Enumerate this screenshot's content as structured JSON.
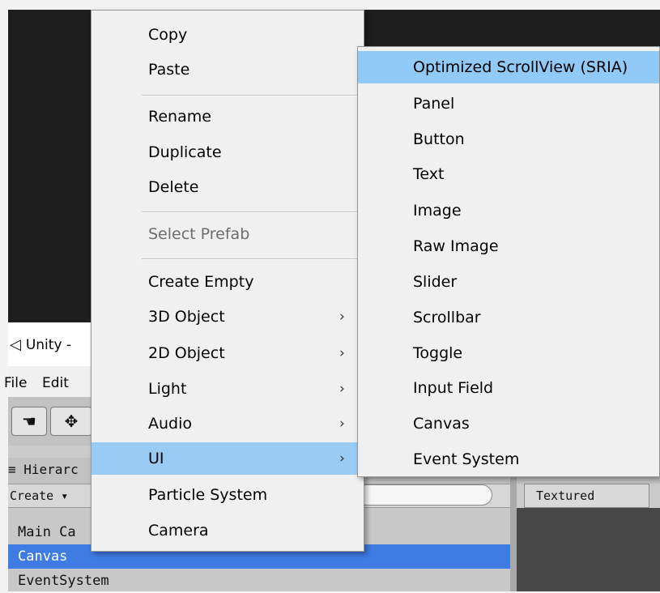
{
  "window": {
    "title": "Unity -",
    "logo_icon": "unity-logo-icon"
  },
  "menubar": {
    "items": [
      "File",
      "Edit"
    ]
  },
  "toolbar": {
    "hand_icon": "hand-tool-icon",
    "move_icon": "move-tool-icon"
  },
  "hierarchy": {
    "tab_label": "≡ Hierarc",
    "create_label": "Create ▾",
    "rows": [
      "Main Ca",
      "Canvas",
      "EventSystem"
    ],
    "selected_row": "Canvas"
  },
  "scene": {
    "textured_label": "Textured"
  },
  "context_menu": {
    "items": [
      {
        "label": "Copy"
      },
      {
        "label": "Paste"
      },
      {
        "label": "Rename"
      },
      {
        "label": "Duplicate"
      },
      {
        "label": "Delete"
      },
      {
        "label": "Select Prefab",
        "disabled": true
      },
      {
        "label": "Create Empty"
      },
      {
        "label": "3D Object",
        "submenu": true
      },
      {
        "label": "2D Object",
        "submenu": true
      },
      {
        "label": "Light",
        "submenu": true
      },
      {
        "label": "Audio",
        "submenu": true
      },
      {
        "label": "UI",
        "submenu": true,
        "highlighted": true
      },
      {
        "label": "Particle System"
      },
      {
        "label": "Camera"
      }
    ],
    "submenu_arrow": "›"
  },
  "ui_submenu": {
    "items": [
      {
        "label": "Optimized ScrollView (SRIA)",
        "highlighted": true
      },
      {
        "label": "Panel"
      },
      {
        "label": "Button"
      },
      {
        "label": "Text"
      },
      {
        "label": "Image"
      },
      {
        "label": "Raw Image"
      },
      {
        "label": "Slider"
      },
      {
        "label": "Scrollbar"
      },
      {
        "label": "Toggle"
      },
      {
        "label": "Input Field"
      },
      {
        "label": "Canvas"
      },
      {
        "label": "Event System"
      }
    ]
  },
  "colors": {
    "highlight": "#91c9f7",
    "selection": "#3e7ce3",
    "menu_bg": "#f0f0f0"
  }
}
